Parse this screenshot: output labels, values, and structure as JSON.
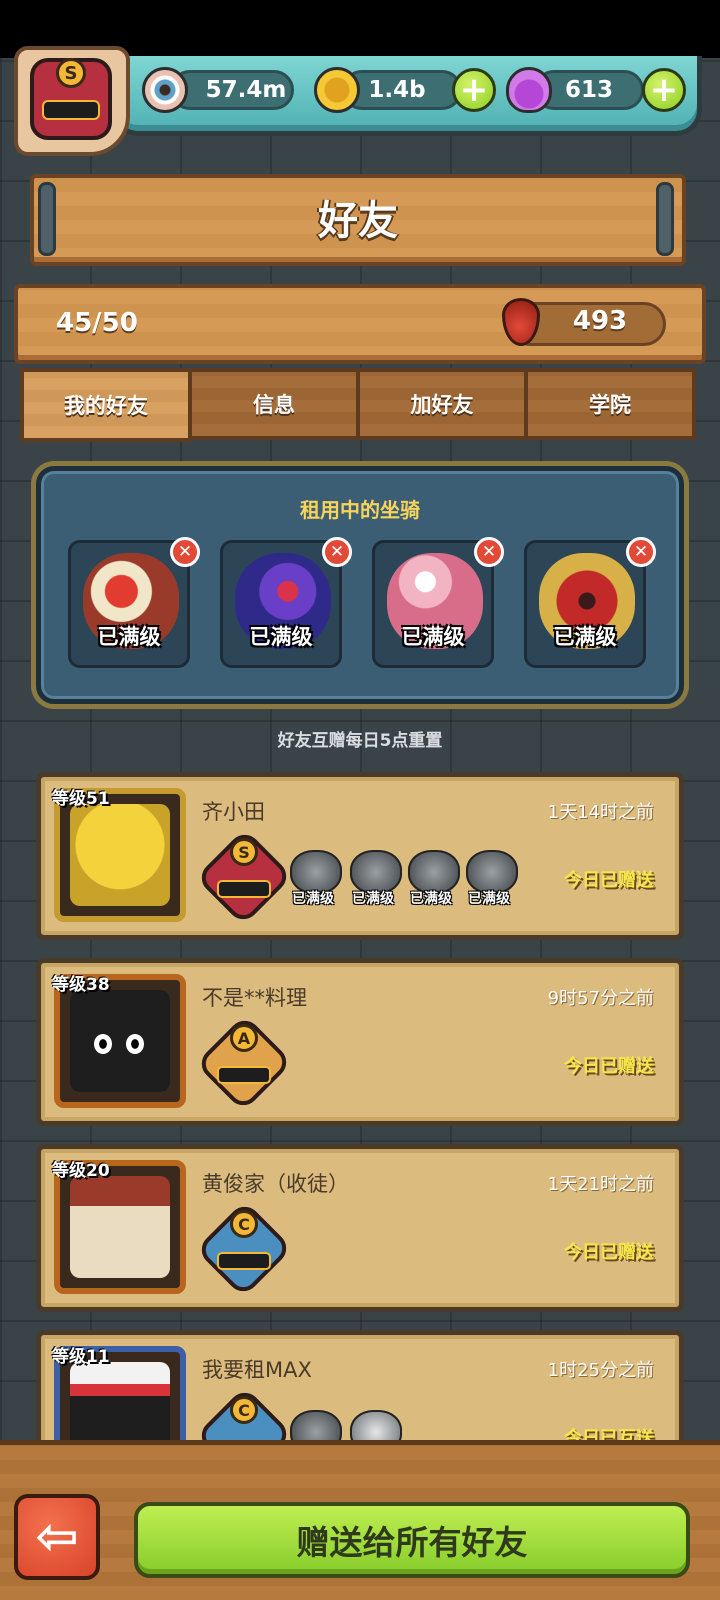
{
  "colors": {
    "wood": "#d59a55",
    "panel_blue": "#3b5e74",
    "card_bg": "#dcbc7e",
    "accent_green": "#86cc2a",
    "gift_text_yellow": "#f8e64a",
    "mount_title_yellow": "#f8d45a"
  },
  "player": {
    "rank_letter": "S",
    "rank_icon": "rank-badge-icon"
  },
  "resources": {
    "eyes": {
      "value": "57.4m",
      "icon": "eyeball-icon"
    },
    "coins": {
      "value": "1.4b",
      "icon": "coin-icon"
    },
    "potions": {
      "value": "613",
      "icon": "potion-icon"
    }
  },
  "header": {
    "title": "好友"
  },
  "stats": {
    "friend_count": "45/50",
    "blood_drops": "493"
  },
  "tabs": [
    {
      "label": "我的好友",
      "active": true
    },
    {
      "label": "信息",
      "active": false
    },
    {
      "label": "加好友",
      "active": false
    },
    {
      "label": "学院",
      "active": false
    }
  ],
  "rented_mounts": {
    "title": "租用中的坐骑",
    "slots": [
      {
        "label": "已满级",
        "icon": "dragon-mount-icon"
      },
      {
        "label": "已满级",
        "icon": "rose-mount-icon"
      },
      {
        "label": "已满级",
        "icon": "flamingo-mount-icon"
      },
      {
        "label": "已满级",
        "icon": "demon-mount-icon"
      }
    ]
  },
  "reset_note": "好友互赠每日5点重置",
  "friends": [
    {
      "level": "等级51",
      "name": "齐小田",
      "time": "1天14时之前",
      "gift_status": "今日已赠送",
      "grade": "S",
      "mounts": [
        {
          "label": "已满级",
          "icon": "dragon-mount-icon"
        },
        {
          "label": "已满级",
          "icon": "demon-mount-icon"
        },
        {
          "label": "已满级",
          "icon": "rose-mount-icon"
        },
        {
          "label": "已满级",
          "icon": "dragon-mount-icon"
        }
      ]
    },
    {
      "level": "等级38",
      "name": "不是**料理",
      "time": "9时57分之前",
      "gift_status": "今日已赠送",
      "grade": "A",
      "mounts": []
    },
    {
      "level": "等级20",
      "name": "黄俊家（收徒）",
      "time": "1天21时之前",
      "gift_status": "今日已赠送",
      "grade": "C",
      "mounts": []
    },
    {
      "level": "等级11",
      "name": "我要租MAX",
      "time": "1时25分之前",
      "gift_status": "今日已互送",
      "grade": "C",
      "mounts": [
        {
          "label": "",
          "icon": "hedgehog-mount-icon"
        },
        {
          "label": "",
          "icon": "pufferfish-mount-icon"
        }
      ]
    }
  ],
  "footer": {
    "gift_all_label": "赠送给所有好友",
    "back_icon": "back-arrow-icon"
  }
}
